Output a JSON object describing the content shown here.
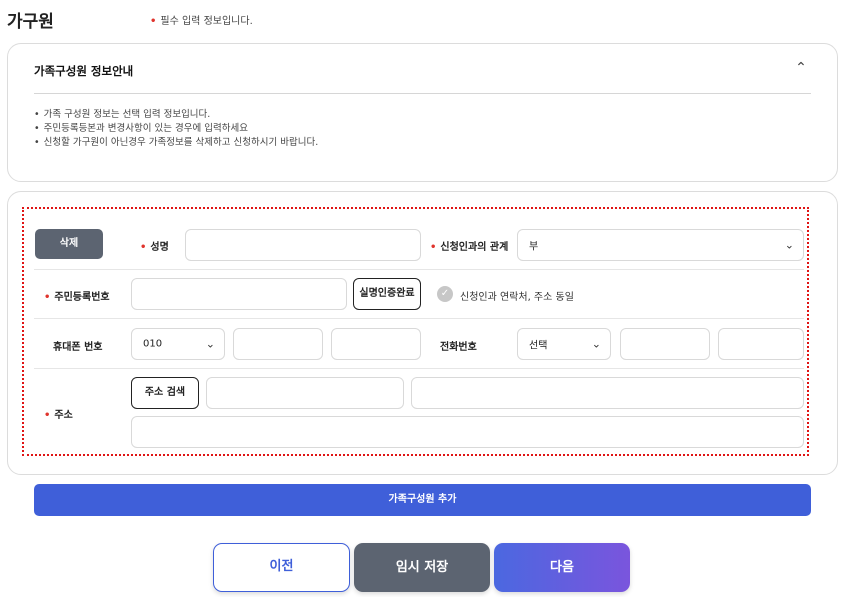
{
  "page": {
    "title": "가구원",
    "required_note": "필수 입력 정보입니다."
  },
  "info": {
    "title": "가족구성원 정보안내",
    "items": [
      "가족 구성원 정보는 선택 입력 정보입니다.",
      "주민등록등본과 변경사항이 있는 경우에 입력하세요",
      "신청할 가구원이 아닌경우 가족정보를 삭제하고 신청하시기 바랍니다."
    ]
  },
  "member": {
    "delete_label": "삭제",
    "name_label": "성명",
    "name_value": "",
    "relation_label": "신청인과의 관계",
    "relation_value": "부",
    "rrn_label": "주민등록번호",
    "rrn_value": "",
    "verify_label": "실명인증완료",
    "same_as_applicant_label": "신청인과 연락처, 주소 동일",
    "mobile_label": "휴대폰 번호",
    "mobile_prefix": "010",
    "mobile_mid": "",
    "mobile_last": "",
    "phone_label": "전화번호",
    "phone_area": "선택",
    "phone_mid": "",
    "phone_last": "",
    "address_label": "주소",
    "address_search_label": "주소 검색",
    "zip_value": "",
    "address_value": "",
    "address_detail_value": ""
  },
  "actions": {
    "add_member_label": "가족구성원 추가",
    "prev_label": "이전",
    "temp_save_label": "임시 저장",
    "next_label": "다음"
  },
  "colors": {
    "primary": "#3f5fd9",
    "gray_button": "#5c6471",
    "required_dot": "#e0342d",
    "highlight_border": "#e01414"
  }
}
